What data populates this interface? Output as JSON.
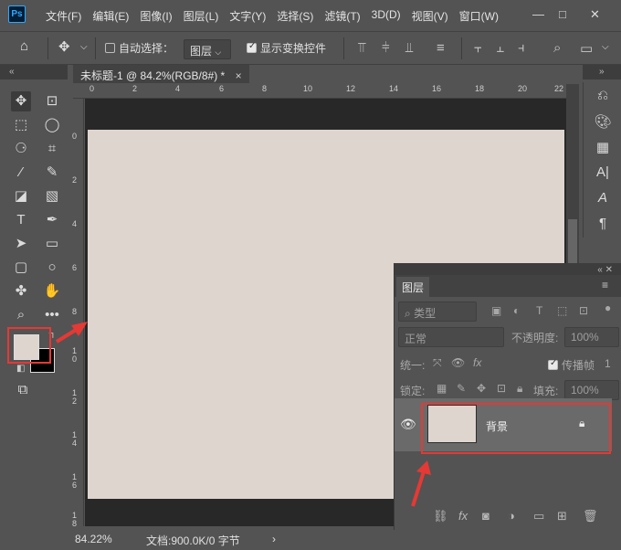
{
  "app": {
    "logo": "Ps"
  },
  "menu": [
    "文件(F)",
    "编辑(E)",
    "图像(I)",
    "图层(L)",
    "文字(Y)",
    "选择(S)",
    "滤镜(T)",
    "3D(D)",
    "视图(V)",
    "窗口(W)"
  ],
  "options": {
    "auto_select_label": "自动选择：",
    "auto_select_value": "图层",
    "show_transform_label": "显示变换控件"
  },
  "document": {
    "tab_title": "未标题-1 @ 84.2%(RGB/8#) *",
    "ruler_top": [
      "0",
      "2",
      "4",
      "6",
      "8",
      "10",
      "12",
      "14",
      "16",
      "18",
      "20",
      "22"
    ],
    "ruler_left": [
      "0",
      "2",
      "4",
      "6",
      "8",
      "1\n0",
      "1\n2",
      "1\n4",
      "1\n6",
      "1\n8"
    ],
    "canvas_color": "#ded5cf"
  },
  "status": {
    "zoom": "84.22%",
    "doc_size": "文档:900.0K/0 字节"
  },
  "colors": {
    "foreground": "#ded5cf",
    "background": "#000000",
    "highlight": "#e53935"
  },
  "layers_panel": {
    "tab": "图层",
    "filter_kind": "类型",
    "blend_mode": "正常",
    "opacity_label": "不透明度:",
    "opacity_value": "100%",
    "unify_label": "统一:",
    "propagate_label": "传播帧",
    "propagate_value": "1",
    "lock_label": "锁定:",
    "fill_label": "填充:",
    "fill_value": "100%",
    "layer": {
      "name": "背景"
    }
  }
}
